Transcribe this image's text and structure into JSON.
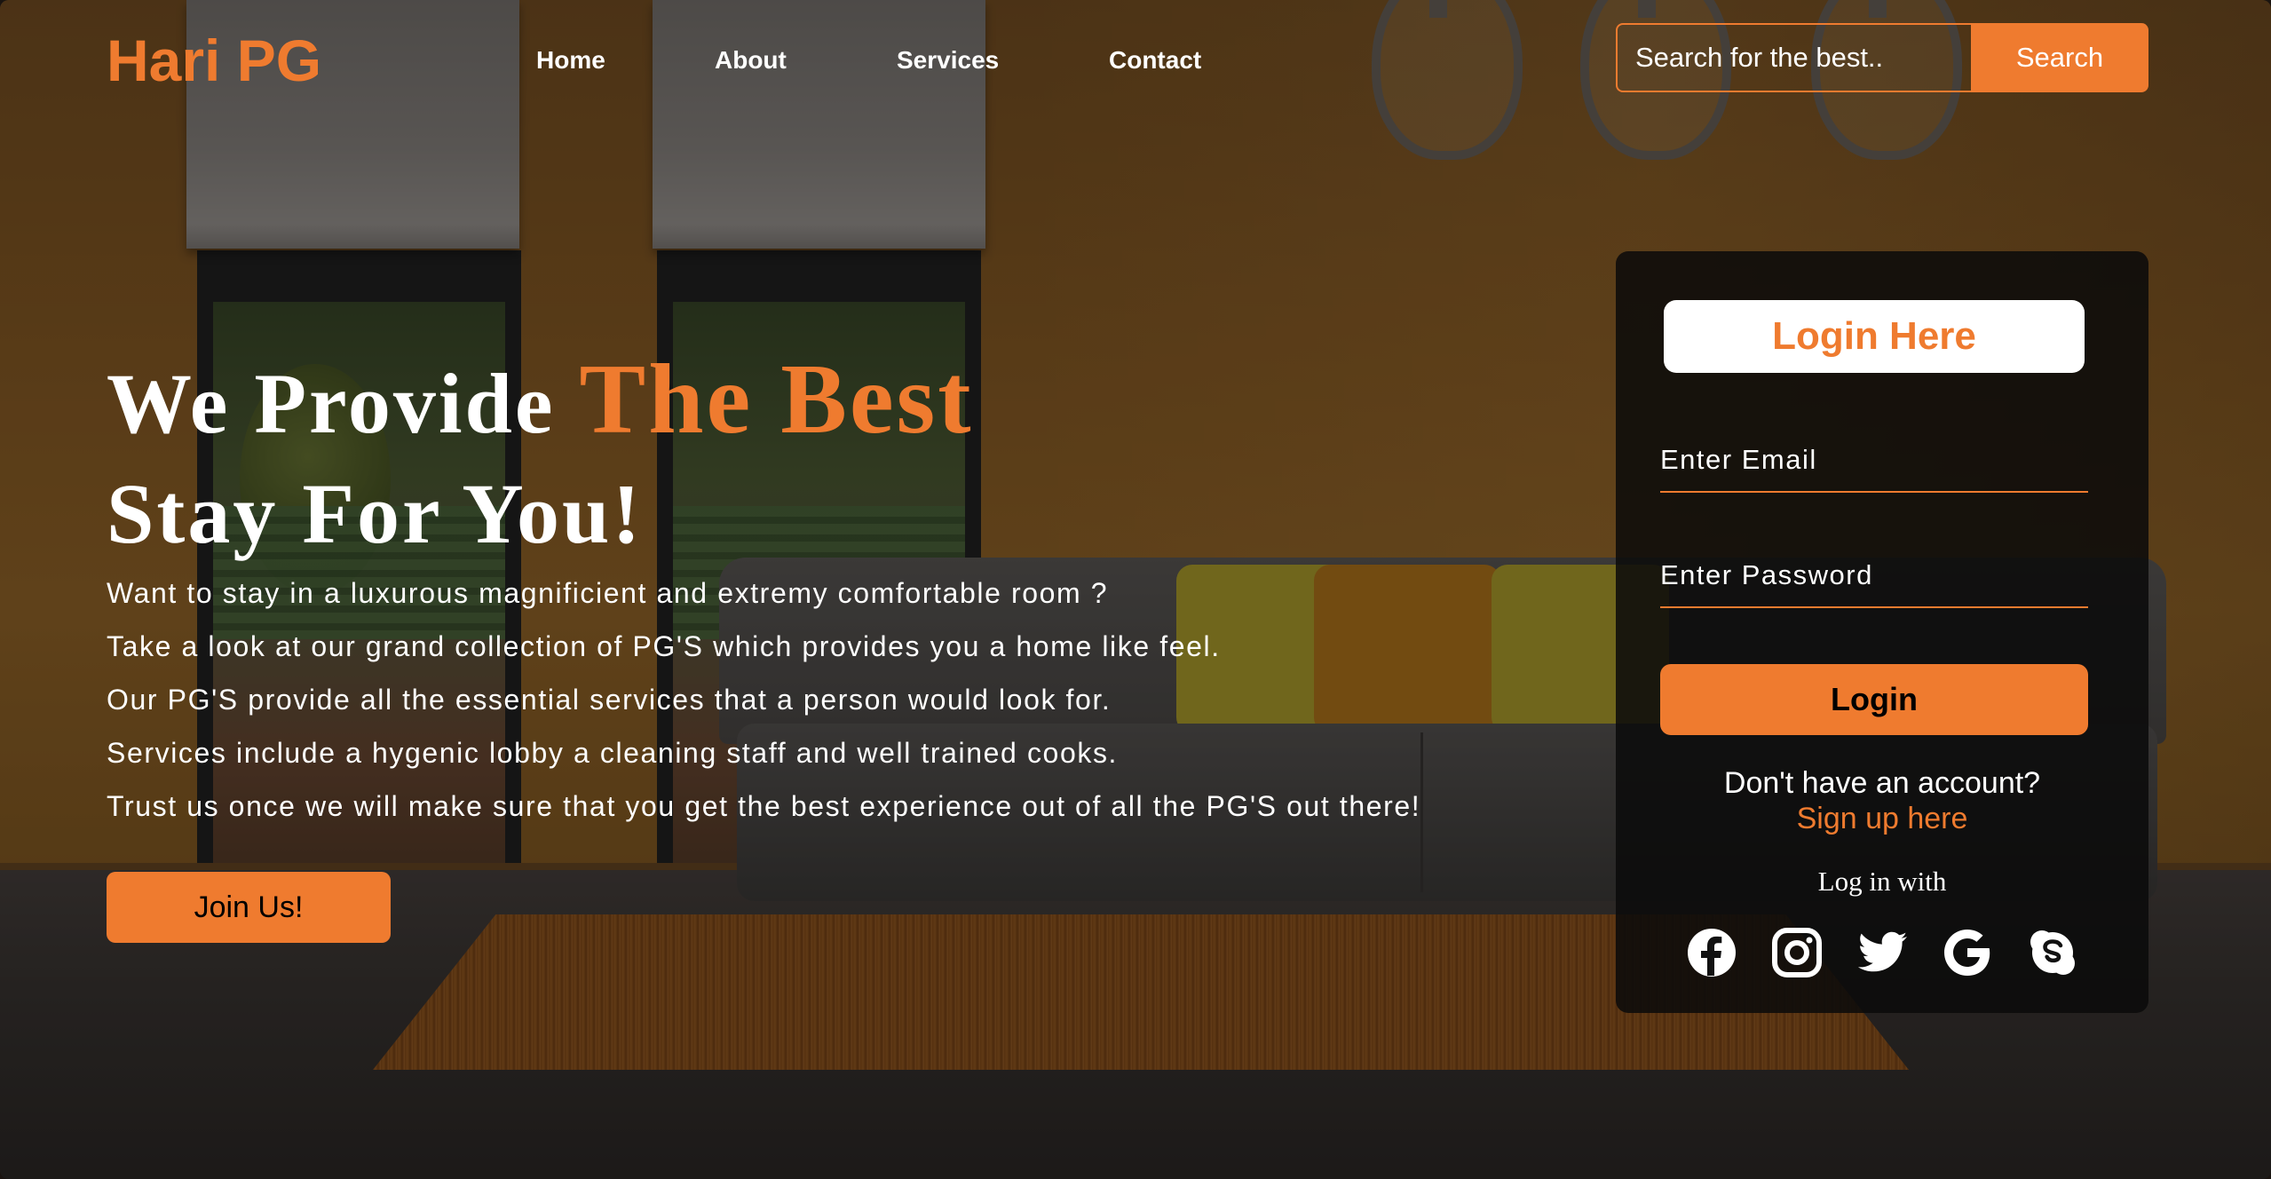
{
  "brand": {
    "name": "Hari PG",
    "accent_color": "#ef7b2f"
  },
  "nav": {
    "items": [
      {
        "label": "Home"
      },
      {
        "label": "About"
      },
      {
        "label": "Services"
      },
      {
        "label": "Contact"
      }
    ]
  },
  "search": {
    "placeholder": "Search for the best..",
    "button_label": "Search"
  },
  "hero": {
    "title_part1": "We Provide ",
    "title_accent": "The Best",
    "title_line2": "Stay For You!",
    "lines": [
      "Want to stay in a luxurous magnificient and extremy comfortable room ?",
      "Take a look at our grand collection of PG'S which provides you a home like feel.",
      "Our PG'S provide all the essential services that a person would look for.",
      "Services include a hygenic lobby a cleaning staff and well trained cooks.",
      "Trust us once we will make sure that you get the best experience out of all the PG'S out there!"
    ],
    "cta_label": "Join Us!"
  },
  "login": {
    "heading": "Login Here",
    "email_placeholder": "Enter Email",
    "password_placeholder": "Enter Password",
    "button_label": "Login",
    "no_account_text": "Don't have an account?",
    "signup_label": "Sign up here",
    "login_with_text": "Log in with",
    "socials": [
      {
        "icon": "facebook-icon"
      },
      {
        "icon": "instagram-icon"
      },
      {
        "icon": "twitter-icon"
      },
      {
        "icon": "google-icon"
      },
      {
        "icon": "skype-icon"
      }
    ]
  }
}
